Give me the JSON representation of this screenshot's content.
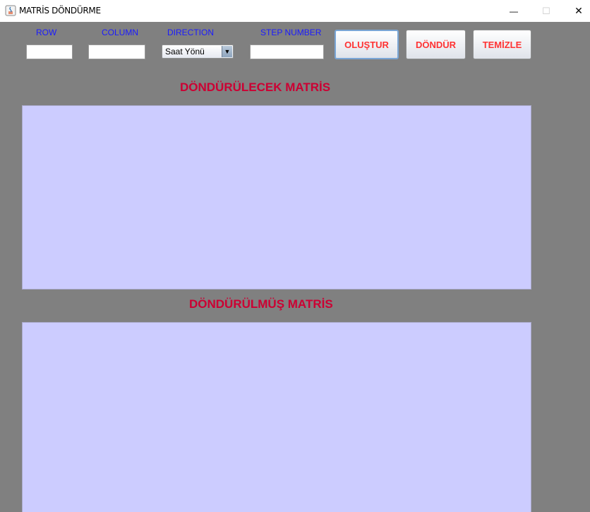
{
  "window": {
    "title": "MATRİS DÖNDÜRME",
    "minimize_glyph": "—",
    "maximize_glyph": "☐",
    "close_glyph": "✕"
  },
  "form": {
    "row_label": "ROW",
    "column_label": "COLUMN",
    "direction_label": "DIRECTION",
    "step_label": "STEP NUMBER",
    "row_value": "",
    "column_value": "",
    "step_value": "",
    "direction_selected": "Saat Yönü",
    "arrow_glyph": "▼"
  },
  "buttons": {
    "create": "OLUŞTUR",
    "rotate": "DÖNDÜR",
    "clear": "TEMİZLE"
  },
  "sections": {
    "input_heading": "DÖNDÜRÜLECEK MATRİS",
    "output_heading": "DÖNDÜRÜLMÜŞ MATRİS"
  },
  "colors": {
    "background": "#808080",
    "label_blue": "#1a1aff",
    "button_text_red": "#ff3333",
    "heading_crimson": "#cc0033",
    "panel_lavender": "#ccccff"
  }
}
